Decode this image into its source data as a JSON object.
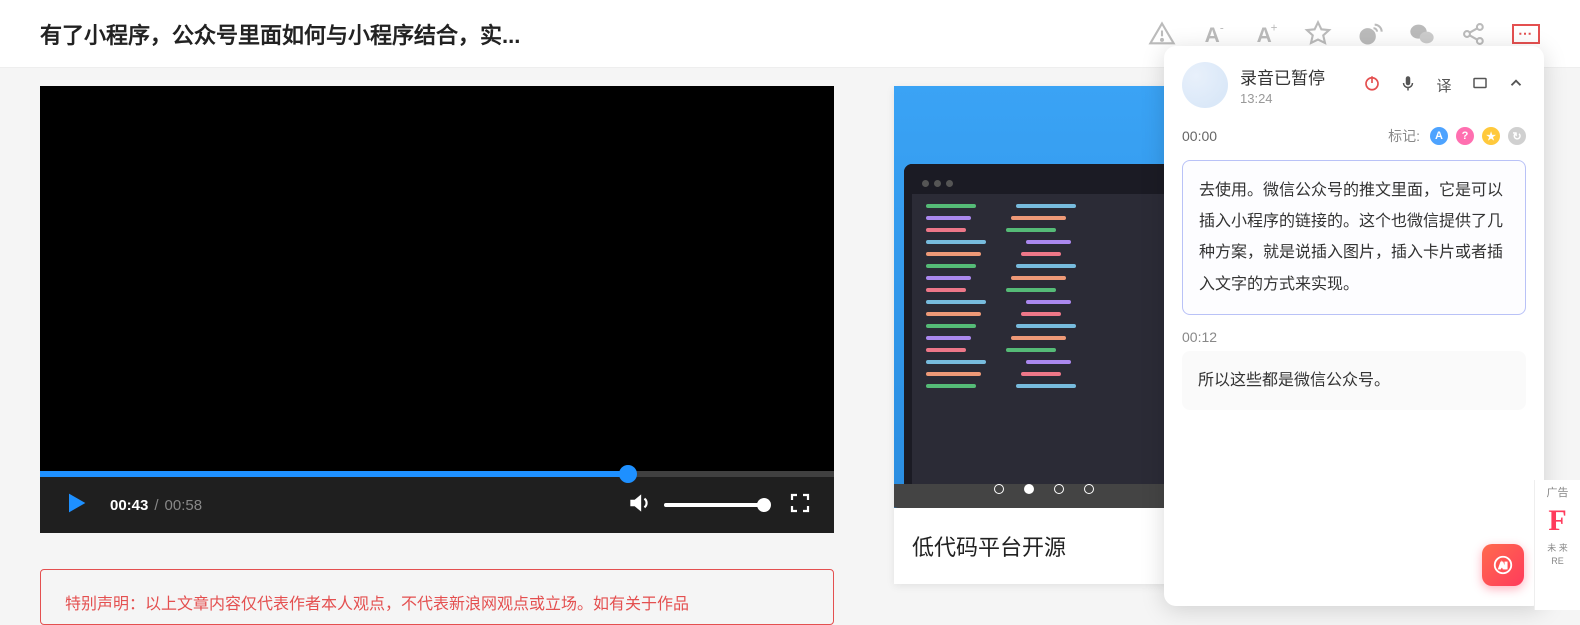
{
  "header": {
    "title": "有了小程序，公众号里面如何与小程序结合，实...",
    "menu_dots": "⋯"
  },
  "video": {
    "current_time": "00:43",
    "separator": "/",
    "duration": "00:58"
  },
  "notice": {
    "text": "特别声明：以上文章内容仅代表作者本人观点，不代表新浪网观点或立场。如有关于作品"
  },
  "ad": {
    "title": "低代码平台开源"
  },
  "panel": {
    "title": "录音已暂停",
    "time": "13:24",
    "translate_label": "译",
    "sub_ts": "00:00",
    "mark_label": "标记:",
    "segments": [
      {
        "ts": "",
        "text": "去使用。微信公众号的推文里面，它是可以插入小程序的链接的。这个也微信提供了几种方案，就是说插入图片，插入卡片或者插入文字的方式来实现。",
        "highlighted": true
      },
      {
        "ts": "00:12",
        "text": "所以这些都是微信公众号。",
        "highlighted": false
      }
    ],
    "fab": "AI"
  },
  "edge_ad": {
    "tag": "广告",
    "big": "F",
    "line1": "未 来",
    "line2": "RE"
  }
}
